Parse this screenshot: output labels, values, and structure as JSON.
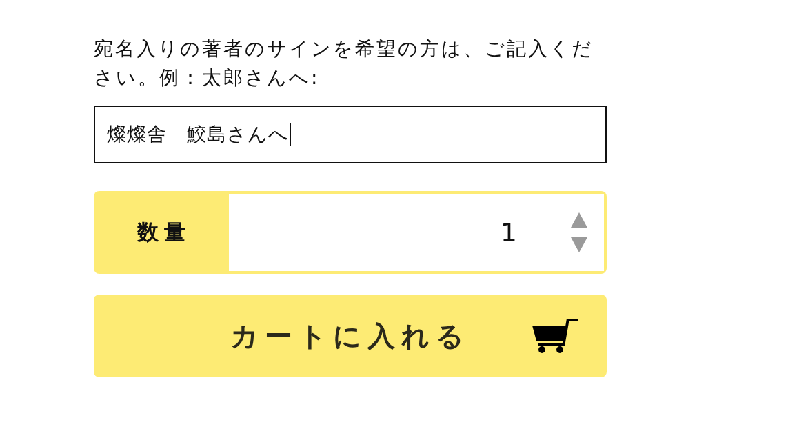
{
  "signature": {
    "label": "宛名入りの著者のサインを希望の方は、ご記入ください。例：太郎さんへ:",
    "value": "燦燦舎　鮫島さんへ",
    "focused": true
  },
  "quantity": {
    "label": "数量",
    "value": "1"
  },
  "add_to_cart": {
    "label": "カートに入れる"
  }
}
